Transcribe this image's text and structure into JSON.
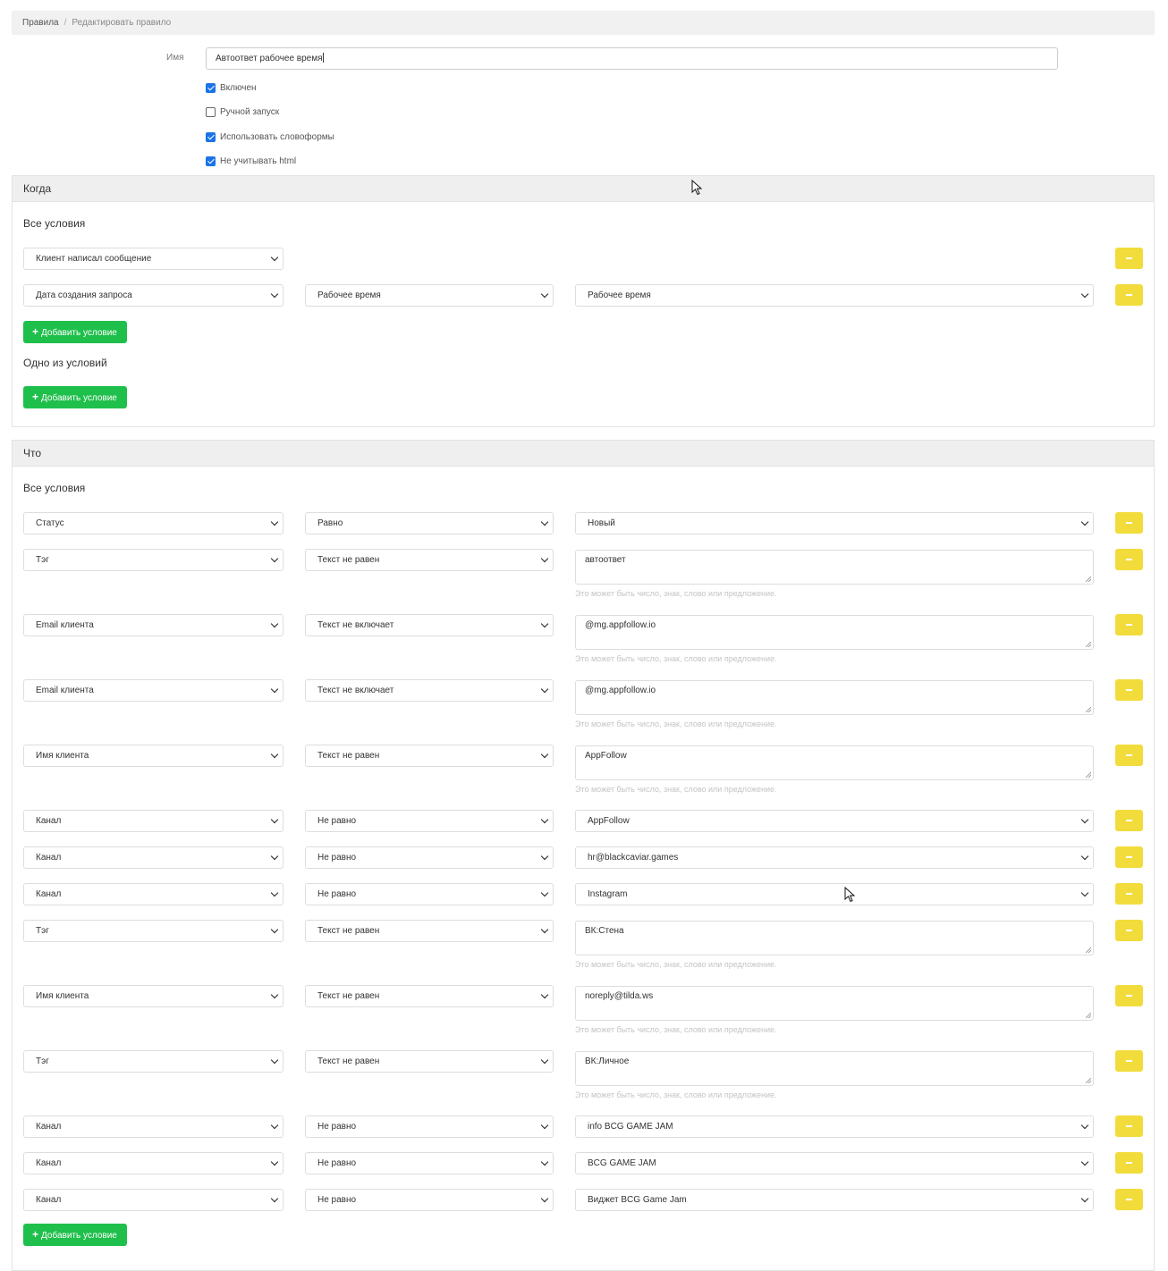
{
  "breadcrumb": {
    "root": "Правила",
    "separator": "/",
    "current": "Редактировать правило"
  },
  "name_field": {
    "label": "Имя",
    "value": "Автоответ рабочее время"
  },
  "checkboxes": [
    {
      "label": "Включен",
      "checked": true
    },
    {
      "label": "Ручной запуск",
      "checked": false
    },
    {
      "label": "Использовать словоформы",
      "checked": true
    },
    {
      "label": "Не учитывать html",
      "checked": true
    }
  ],
  "when": {
    "title": "Когда",
    "all_title": "Все условия",
    "any_title": "Одно из условий",
    "add_label": "Добавить условие",
    "rows": [
      {
        "field": "Клиент написал сообщение"
      },
      {
        "field": "Дата создания запроса",
        "operator": "Рабочее время",
        "value": "Рабочее время"
      }
    ]
  },
  "what": {
    "title": "Что",
    "all_title": "Все условия",
    "add_label": "Добавить условие",
    "help_text": "Это может быть число, знак, слово или предложение.",
    "rows": [
      {
        "field": "Статус",
        "operator": "Равно",
        "value": "Новый",
        "kind": "select"
      },
      {
        "field": "Тэг",
        "operator": "Текст не равен",
        "value": "автоответ",
        "kind": "text"
      },
      {
        "field": "Email клиента",
        "operator": "Текст не включает",
        "value": "@mg.appfollow.io",
        "kind": "text"
      },
      {
        "field": "Email клиента",
        "operator": "Текст не включает",
        "value": "@mg.appfollow.io",
        "kind": "text"
      },
      {
        "field": "Имя клиента",
        "operator": "Текст не равен",
        "value": "AppFollow",
        "kind": "text"
      },
      {
        "field": "Канал",
        "operator": "Не равно",
        "value": "AppFollow",
        "kind": "select"
      },
      {
        "field": "Канал",
        "operator": "Не равно",
        "value": "hr@blackcaviar.games",
        "kind": "select"
      },
      {
        "field": "Канал",
        "operator": "Не равно",
        "value": "Instagram",
        "kind": "select"
      },
      {
        "field": "Тэг",
        "operator": "Текст не равен",
        "value": "ВК:Стена",
        "kind": "text"
      },
      {
        "field": "Имя клиента",
        "operator": "Текст не равен",
        "value": "noreply@tilda.ws",
        "kind": "text"
      },
      {
        "field": "Тэг",
        "operator": "Текст не равен",
        "value": "ВК:Личное",
        "kind": "text"
      },
      {
        "field": "Канал",
        "operator": "Не равно",
        "value": "info BCG GAME JAM",
        "kind": "select"
      },
      {
        "field": "Канал",
        "operator": "Не равно",
        "value": "BCG GAME JAM",
        "kind": "select"
      },
      {
        "field": "Канал",
        "operator": "Не равно",
        "value": "Виджет BCG Game Jam",
        "kind": "select"
      }
    ]
  },
  "colors": {
    "accent_blue": "#1a73e8",
    "add_green": "#1fbf4b",
    "remove_yellow": "#f2dc3c",
    "header_gray": "#efefef"
  },
  "icons": {
    "dropdown": "chevron-down-icon",
    "remove": "minus-icon",
    "add": "plus-icon",
    "cursor": "mouse-pointer-icon"
  }
}
